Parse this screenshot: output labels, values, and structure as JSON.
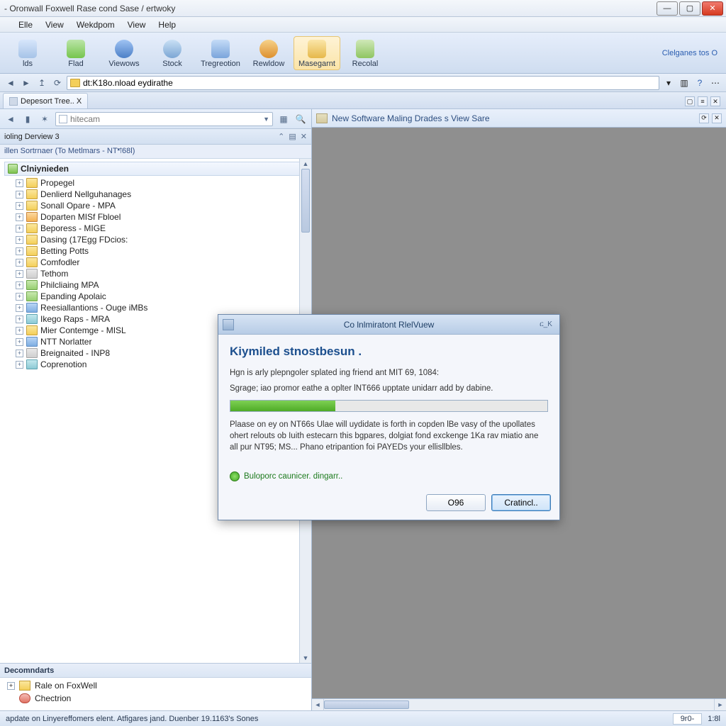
{
  "window": {
    "title": "- Oronwall Foxwell Rase cond Sase / ertwoky"
  },
  "menu": [
    "Elle",
    "View",
    "Wekdpom",
    "View",
    "Help"
  ],
  "toolbar": {
    "items": [
      {
        "label": "lds",
        "icon": "i0"
      },
      {
        "label": "Flad",
        "icon": "i1"
      },
      {
        "label": "Viewows",
        "icon": "i2"
      },
      {
        "label": "Stock",
        "icon": "i3"
      },
      {
        "label": "Tregreotion",
        "icon": "i4"
      },
      {
        "label": "Rewldow",
        "icon": "i5"
      },
      {
        "label": "Masegarnt",
        "icon": "i7",
        "active": true
      },
      {
        "label": "Recolal",
        "icon": "i8"
      }
    ],
    "right_link": "Clelganes tos   O"
  },
  "address": {
    "value": "dt:K18o.nload eydirathe"
  },
  "doc_tab": "Depesort Tree.. X",
  "left": {
    "search_placeholder": "hitecam",
    "header": "ioling Derview 3",
    "subheader": "illen Sortrnaer (To Metlmars - NTশ68l)",
    "root": "Clniynieden",
    "nodes": [
      {
        "label": "Propegel",
        "ico": "node-ico"
      },
      {
        "label": "Denlierd Nellguhanages",
        "ico": "node-ico"
      },
      {
        "label": "Sonall Opare - MPA",
        "ico": "node-ico"
      },
      {
        "label": "Doparten MISf Fbloel",
        "ico": "node-ico orange"
      },
      {
        "label": "Beporess - MIGE",
        "ico": "node-ico"
      },
      {
        "label": "Dasing (17Egg FDcios:",
        "ico": "node-ico"
      },
      {
        "label": "Betting Potts",
        "ico": "node-ico"
      },
      {
        "label": "Comfodler",
        "ico": "node-ico"
      },
      {
        "label": "Tethom",
        "ico": "node-ico gray"
      },
      {
        "label": "Philcliaing MPA",
        "ico": "node-ico green"
      },
      {
        "label": "Epanding Apolaiс",
        "ico": "node-ico green"
      },
      {
        "label": "Reesiallantions - Ouge iMBs",
        "ico": "node-ico blue"
      },
      {
        "label": "Ikego Raps - MRA",
        "ico": "node-ico cyan"
      },
      {
        "label": "Mier Contemge - MISL",
        "ico": "node-ico"
      },
      {
        "label": "NTT Norlatter",
        "ico": "node-ico blue"
      },
      {
        "label": "Breignaited - INP8",
        "ico": "node-ico gray"
      },
      {
        "label": "Coprenotion",
        "ico": "node-ico cyan"
      }
    ],
    "doc_header": "Decomndarts",
    "docs": [
      {
        "label": "Rale on FoxWell",
        "ico": "y"
      },
      {
        "label": "Chectrion",
        "ico": "r"
      }
    ]
  },
  "right": {
    "tab_title": "New Software Maling Drades s View Sare"
  },
  "dialog": {
    "title": "Co lnlmiratont RlelVuew",
    "close": "ር_K",
    "heading": "Kiymiled stnostbesun .",
    "line1": "Hgn is arly plepngoler splated ing friend ant MIT 69, 1084:",
    "line2": "Sgrage; iao promor eathe a oplter lNT666 upptate unidarr add by dabine.",
    "body": "Plaase on ey on NT66s Ulae will uydidate is forth in copden lBe vasy of the upollates ohert relouts ob Iuith estecarn this bgpares, dolgiat fond exckenge 1Ka rav miatio ane all pur NT95; MS... Phano etripantion foi PAYEDs your ellisllbles.",
    "link_text": "Buloporc caunicer. dingarr..",
    "btn_ok": "O96",
    "btn_primary": "Cratincl.."
  },
  "status": {
    "left": "apdate on Linyereffomers elent. Atfigares jand. Duenber 19.1163's Sones",
    "cell1": "9r0-",
    "cell2": "1:8l"
  }
}
